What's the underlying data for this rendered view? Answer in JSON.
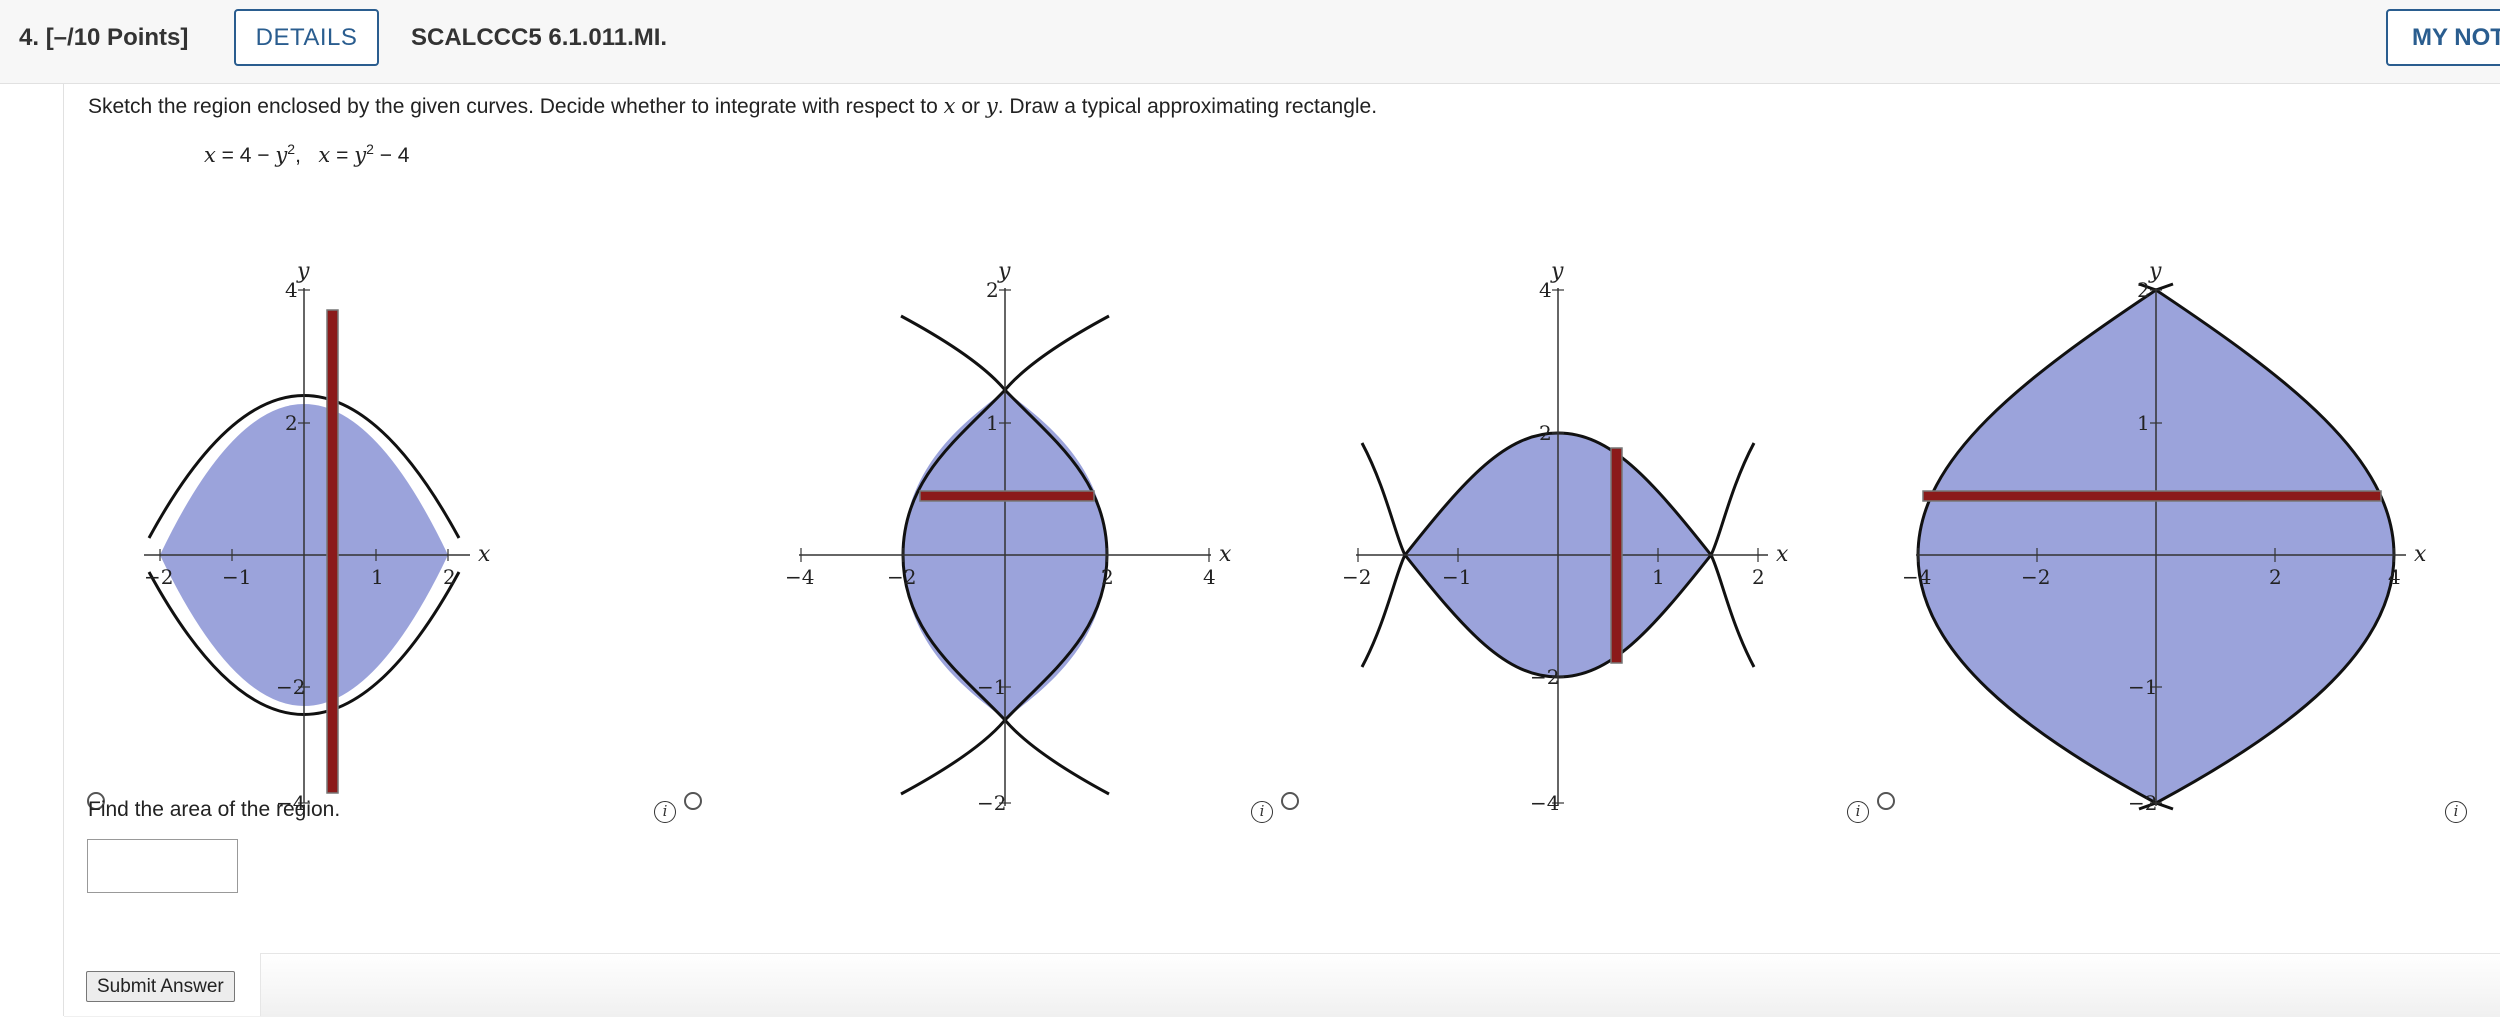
{
  "header": {
    "question_number": "4.",
    "points": "[–/10 Points]",
    "details_label": "DETAILS",
    "problem_code": "SCALCCC5 6.1.011.MI.",
    "my_notes_label": "MY NOTES"
  },
  "question": {
    "prompt_before_x": "Sketch the region enclosed by the given curves. Decide whether to integrate with respect to ",
    "prompt_x": "x",
    "prompt_or": " or ",
    "prompt_y": "y",
    "prompt_after": ". Draw a typical approximating rectangle.",
    "equation": {
      "eq1_var": "x",
      "eq1_mid": " = 4 − ",
      "eq1_y": "y",
      "eq1_pow": "2",
      "sep": ",   ",
      "eq2_var": "x",
      "eq2_mid": " = ",
      "eq2_y": "y",
      "eq2_pow": "2",
      "eq2_end": " − 4"
    }
  },
  "options": [
    {
      "x_axis_label": "x",
      "y_axis_label": "y",
      "x_ticks": [
        "−2",
        "−1",
        "1",
        "2"
      ],
      "y_ticks": [
        "4",
        "2",
        "−2",
        "−4"
      ],
      "rectangle": "vertical"
    },
    {
      "x_axis_label": "x",
      "y_axis_label": "y",
      "x_ticks": [
        "−4",
        "−2",
        "2",
        "4"
      ],
      "y_ticks": [
        "2",
        "1",
        "−1",
        "−2"
      ],
      "rectangle": "horizontal"
    },
    {
      "x_axis_label": "x",
      "y_axis_label": "y",
      "x_ticks": [
        "−2",
        "−1",
        "1",
        "2"
      ],
      "y_ticks": [
        "4",
        "2",
        "−2",
        "−4"
      ],
      "rectangle": "vertical"
    },
    {
      "x_axis_label": "x",
      "y_axis_label": "y",
      "x_ticks": [
        "−4",
        "−2",
        "2",
        "4"
      ],
      "y_ticks": [
        "2",
        "1",
        "−1",
        "−2"
      ],
      "rectangle": "horizontal"
    }
  ],
  "colors": {
    "region_fill": "#9ba3db",
    "rectangle": "#8b1a1a",
    "curve": "#111111"
  },
  "info_icon_glyph": "i",
  "area": {
    "prompt": "Find the area of the region.",
    "answer_value": ""
  },
  "submit_label": "Submit Answer"
}
